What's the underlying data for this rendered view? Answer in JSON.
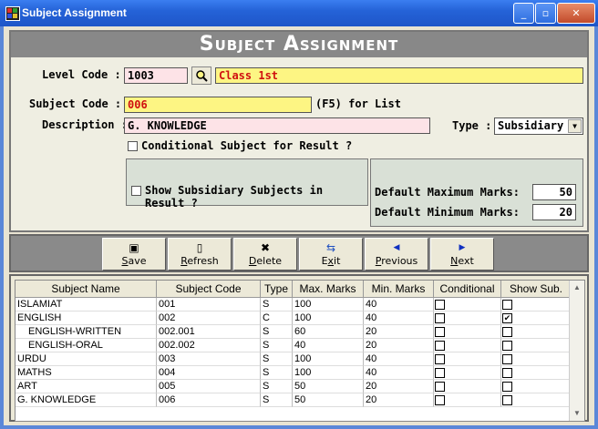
{
  "window": {
    "title": "Subject Assignment"
  },
  "header": {
    "title": "Subject Assignment"
  },
  "form": {
    "level_code_label": "Level Code :",
    "level_code": "1003",
    "level_name": "Class 1st",
    "subject_code_label": "Subject Code :",
    "subject_code": "006",
    "f5_hint": "(F5) for List",
    "description_label": "Description :",
    "description": "G. KNOWLEDGE",
    "type_label": "Type :",
    "type_value": "Subsidiary",
    "conditional_label": "Conditional Subject for Result ?",
    "show_subsidiary_label": "Show Subsidiary Subjects in Result ?",
    "max_marks_label": "Default Maximum Marks:",
    "max_marks": "50",
    "min_marks_label": "Default Minimum Marks:",
    "min_marks": "20"
  },
  "toolbar": {
    "save": "ave",
    "save_key": "S",
    "refresh": "efresh",
    "refresh_key": "R",
    "delete": "elete",
    "delete_key": "D",
    "exit": "it",
    "exit_key": "E",
    "exit_mid": "x",
    "previous": "revious",
    "previous_key": "P",
    "next": "ext",
    "next_key": "N"
  },
  "grid": {
    "columns": [
      "Subject Name",
      "Subject Code",
      "Type",
      "Max. Marks",
      "Min. Marks",
      "Conditional",
      "Show Sub."
    ],
    "rows": [
      {
        "name": "ISLAMIAT",
        "code": "001",
        "type": "S",
        "max": "100",
        "min": "40",
        "conditional": false,
        "show_sub": false
      },
      {
        "name": "ENGLISH",
        "code": "002",
        "type": "C",
        "max": "100",
        "min": "40",
        "conditional": false,
        "show_sub": true
      },
      {
        "name": "ENGLISH-WRITTEN",
        "code": "002.001",
        "type": "S",
        "max": "60",
        "min": "20",
        "conditional": false,
        "show_sub": false
      },
      {
        "name": "ENGLISH-ORAL",
        "code": "002.002",
        "type": "S",
        "max": "40",
        "min": "20",
        "conditional": false,
        "show_sub": false
      },
      {
        "name": "URDU",
        "code": "003",
        "type": "S",
        "max": "100",
        "min": "40",
        "conditional": false,
        "show_sub": false
      },
      {
        "name": "MATHS",
        "code": "004",
        "type": "S",
        "max": "100",
        "min": "40",
        "conditional": false,
        "show_sub": false
      },
      {
        "name": "ART",
        "code": "005",
        "type": "S",
        "max": "50",
        "min": "20",
        "conditional": false,
        "show_sub": false
      },
      {
        "name": "G. KNOWLEDGE",
        "code": "006",
        "type": "S",
        "max": "50",
        "min": "20",
        "conditional": false,
        "show_sub": false
      }
    ]
  }
}
